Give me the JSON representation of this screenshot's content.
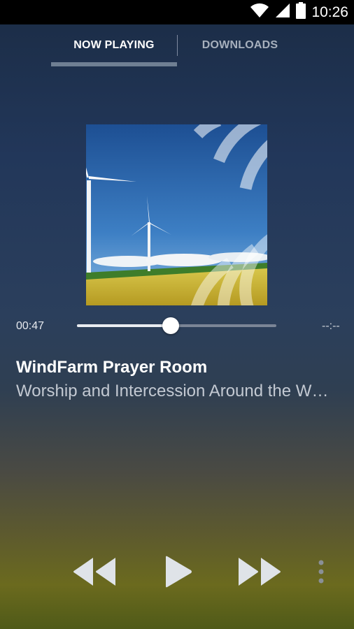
{
  "status_bar": {
    "time": "10:26"
  },
  "tabs": [
    {
      "label": "NOW PLAYING",
      "active": true
    },
    {
      "label": "DOWNLOADS",
      "active": false
    }
  ],
  "player": {
    "current_time": "00:47",
    "total_time": "--:--",
    "progress": 0.47,
    "title": "WindFarm Prayer Room",
    "subtitle": "Worship and Intercession Around the W…"
  },
  "colors": {
    "accent": "#6f7f93",
    "sky": "#2f6fb6",
    "field": "#c9b52f"
  },
  "icons": [
    "wifi-icon",
    "signal-icon",
    "battery-icon",
    "rewind-icon",
    "play-icon",
    "fast-forward-icon",
    "overflow-menu-icon"
  ]
}
